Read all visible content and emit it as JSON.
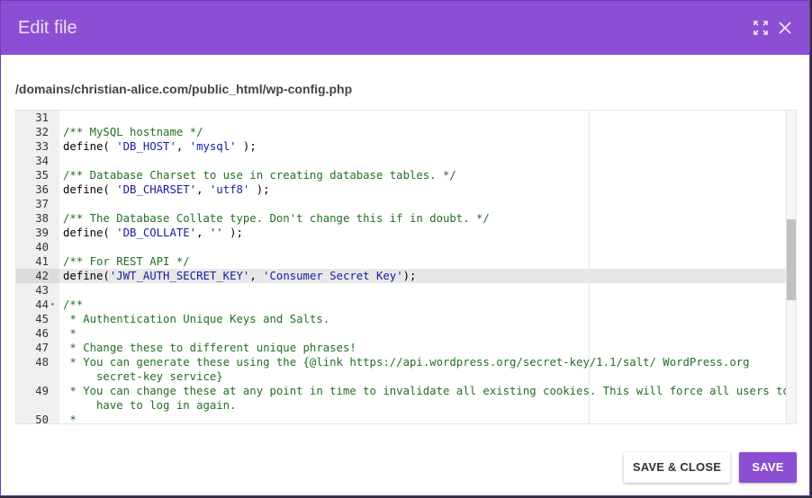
{
  "dialog": {
    "title": "Edit file",
    "file_path": "/domains/christian-alice.com/public_html/wp-config.php"
  },
  "icons": {
    "fullscreen": "fullscreen-icon",
    "close": "close-icon"
  },
  "editor": {
    "active_line": 42,
    "lines": [
      {
        "n": "31",
        "parts": []
      },
      {
        "n": "32",
        "parts": [
          {
            "t": "c",
            "v": "/** MySQL hostname */"
          }
        ]
      },
      {
        "n": "33",
        "parts": [
          {
            "t": "p",
            "v": "define( "
          },
          {
            "t": "s",
            "v": "'DB_HOST'"
          },
          {
            "t": "p",
            "v": ", "
          },
          {
            "t": "s",
            "v": "'mysql'"
          },
          {
            "t": "p",
            "v": " );"
          }
        ]
      },
      {
        "n": "34",
        "parts": []
      },
      {
        "n": "35",
        "parts": [
          {
            "t": "c",
            "v": "/** Database Charset to use in creating database tables. */"
          }
        ]
      },
      {
        "n": "36",
        "parts": [
          {
            "t": "p",
            "v": "define( "
          },
          {
            "t": "s",
            "v": "'DB_CHARSET'"
          },
          {
            "t": "p",
            "v": ", "
          },
          {
            "t": "s",
            "v": "'utf8'"
          },
          {
            "t": "p",
            "v": " );"
          }
        ]
      },
      {
        "n": "37",
        "parts": []
      },
      {
        "n": "38",
        "parts": [
          {
            "t": "c",
            "v": "/** The Database Collate type. Don't change this if in doubt. */"
          }
        ]
      },
      {
        "n": "39",
        "parts": [
          {
            "t": "p",
            "v": "define( "
          },
          {
            "t": "s",
            "v": "'DB_COLLATE'"
          },
          {
            "t": "p",
            "v": ", "
          },
          {
            "t": "s",
            "v": "''"
          },
          {
            "t": "p",
            "v": " );"
          }
        ]
      },
      {
        "n": "40",
        "parts": []
      },
      {
        "n": "41",
        "parts": [
          {
            "t": "c",
            "v": "/** For REST API */"
          }
        ]
      },
      {
        "n": "42",
        "parts": [
          {
            "t": "p",
            "v": "define("
          },
          {
            "t": "s",
            "v": "'JWT_AUTH_SECRET_KEY'"
          },
          {
            "t": "p",
            "v": ", "
          },
          {
            "t": "s",
            "v": "'Consumer Secret Key'"
          },
          {
            "t": "p",
            "v": ");"
          }
        ]
      },
      {
        "n": "43",
        "parts": []
      },
      {
        "n": "44",
        "fold": true,
        "parts": [
          {
            "t": "c",
            "v": "/**"
          }
        ]
      },
      {
        "n": "45",
        "parts": [
          {
            "t": "c",
            "v": " * Authentication Unique Keys and Salts."
          }
        ]
      },
      {
        "n": "46",
        "parts": [
          {
            "t": "c",
            "v": " *"
          }
        ]
      },
      {
        "n": "47",
        "parts": [
          {
            "t": "c",
            "v": " * Change these to different unique phrases!"
          }
        ]
      },
      {
        "n": "48",
        "parts": [
          {
            "t": "c",
            "v": " * You can generate these using the {@link https://api.wordpress.org/secret-key/1.1/salt/ WordPress.org"
          }
        ]
      },
      {
        "n": "",
        "parts": [
          {
            "t": "c",
            "v": "     secret-key service}"
          }
        ]
      },
      {
        "n": "49",
        "parts": [
          {
            "t": "c",
            "v": " * You can change these at any point in time to invalidate all existing cookies. This will force all users to"
          }
        ]
      },
      {
        "n": "",
        "parts": [
          {
            "t": "c",
            "v": "     have to log in again."
          }
        ]
      },
      {
        "n": "50",
        "parts": [
          {
            "t": "c",
            "v": " *"
          }
        ]
      }
    ]
  },
  "buttons": {
    "save_close": "SAVE & CLOSE",
    "save": "SAVE"
  },
  "colors": {
    "accent": "#8c4fd3",
    "comment": "#236e24",
    "string": "#1a1aa6"
  }
}
